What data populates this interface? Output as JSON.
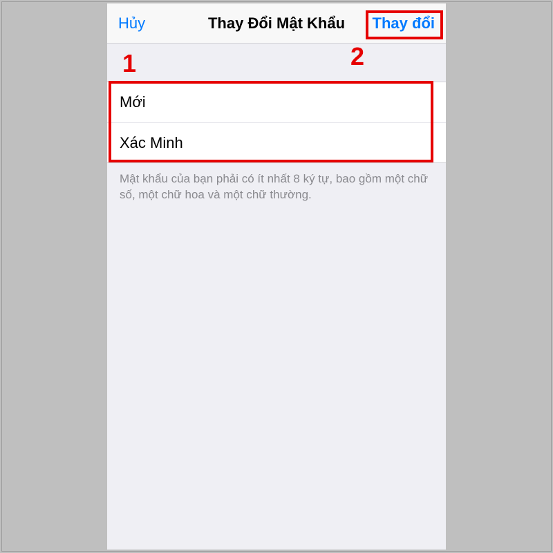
{
  "nav": {
    "cancel_label": "Hủy",
    "title": "Thay Đổi Mật Khẩu",
    "confirm_label": "Thay đổi"
  },
  "fields": {
    "new_label": "Mới",
    "verify_label": "Xác Minh"
  },
  "hint": "Mật khẩu của bạn phải có ít nhất 8 ký tự, bao gồm một chữ số, một chữ hoa và một chữ thường.",
  "annotations": {
    "label_1": "1",
    "label_2": "2"
  },
  "colors": {
    "ios_blue": "#007aff",
    "annotation_red": "#e60000",
    "bg_gray": "#efeff4",
    "hint_gray": "#8a8a8f"
  }
}
